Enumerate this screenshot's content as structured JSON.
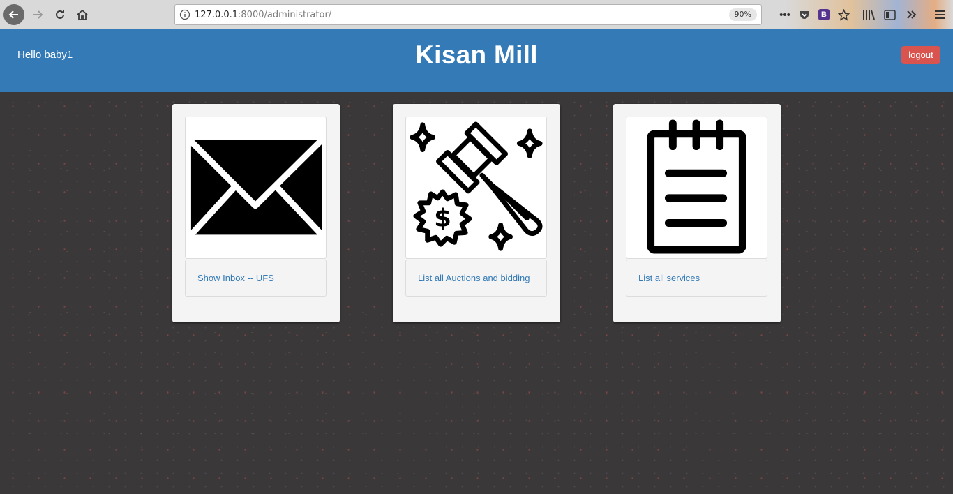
{
  "browser": {
    "url_host": "127.0.0.1",
    "url_rest": ":8000/administrator/",
    "zoom": "90%"
  },
  "header": {
    "greeting": "Hello baby1",
    "brand": "Kisan Mill",
    "logout_label": "logout",
    "colors": {
      "navbar": "#337ab7",
      "logout": "#d9534f"
    }
  },
  "cards": [
    {
      "label": "Show Inbox -- UFS",
      "icon": "envelope-icon"
    },
    {
      "label": "List all Auctions and bidding",
      "icon": "auction-gavel-icon"
    },
    {
      "label": "List all services",
      "icon": "notepad-icon"
    }
  ]
}
